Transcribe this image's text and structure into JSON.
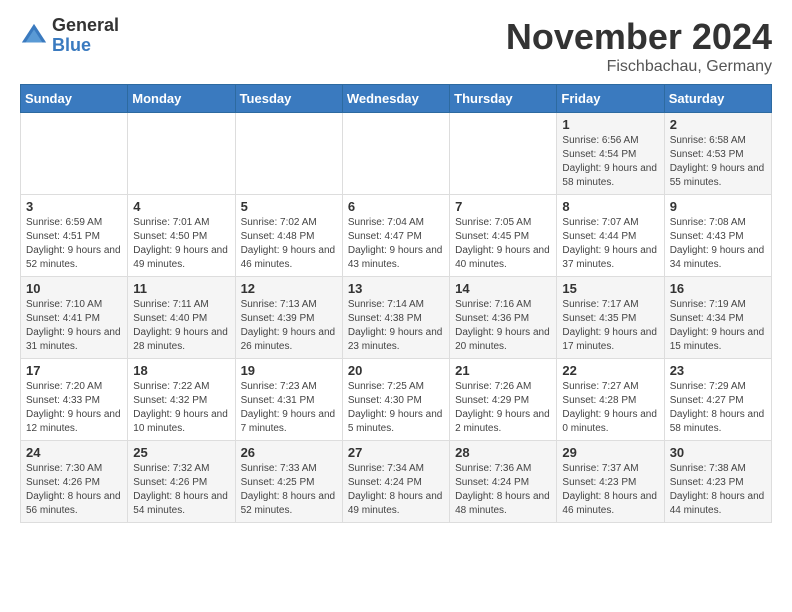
{
  "header": {
    "logo_general": "General",
    "logo_blue": "Blue",
    "title": "November 2024",
    "location": "Fischbachau, Germany"
  },
  "weekdays": [
    "Sunday",
    "Monday",
    "Tuesday",
    "Wednesday",
    "Thursday",
    "Friday",
    "Saturday"
  ],
  "weeks": [
    [
      {
        "day": "",
        "info": ""
      },
      {
        "day": "",
        "info": ""
      },
      {
        "day": "",
        "info": ""
      },
      {
        "day": "",
        "info": ""
      },
      {
        "day": "",
        "info": ""
      },
      {
        "day": "1",
        "info": "Sunrise: 6:56 AM\nSunset: 4:54 PM\nDaylight: 9 hours and 58 minutes."
      },
      {
        "day": "2",
        "info": "Sunrise: 6:58 AM\nSunset: 4:53 PM\nDaylight: 9 hours and 55 minutes."
      }
    ],
    [
      {
        "day": "3",
        "info": "Sunrise: 6:59 AM\nSunset: 4:51 PM\nDaylight: 9 hours and 52 minutes."
      },
      {
        "day": "4",
        "info": "Sunrise: 7:01 AM\nSunset: 4:50 PM\nDaylight: 9 hours and 49 minutes."
      },
      {
        "day": "5",
        "info": "Sunrise: 7:02 AM\nSunset: 4:48 PM\nDaylight: 9 hours and 46 minutes."
      },
      {
        "day": "6",
        "info": "Sunrise: 7:04 AM\nSunset: 4:47 PM\nDaylight: 9 hours and 43 minutes."
      },
      {
        "day": "7",
        "info": "Sunrise: 7:05 AM\nSunset: 4:45 PM\nDaylight: 9 hours and 40 minutes."
      },
      {
        "day": "8",
        "info": "Sunrise: 7:07 AM\nSunset: 4:44 PM\nDaylight: 9 hours and 37 minutes."
      },
      {
        "day": "9",
        "info": "Sunrise: 7:08 AM\nSunset: 4:43 PM\nDaylight: 9 hours and 34 minutes."
      }
    ],
    [
      {
        "day": "10",
        "info": "Sunrise: 7:10 AM\nSunset: 4:41 PM\nDaylight: 9 hours and 31 minutes."
      },
      {
        "day": "11",
        "info": "Sunrise: 7:11 AM\nSunset: 4:40 PM\nDaylight: 9 hours and 28 minutes."
      },
      {
        "day": "12",
        "info": "Sunrise: 7:13 AM\nSunset: 4:39 PM\nDaylight: 9 hours and 26 minutes."
      },
      {
        "day": "13",
        "info": "Sunrise: 7:14 AM\nSunset: 4:38 PM\nDaylight: 9 hours and 23 minutes."
      },
      {
        "day": "14",
        "info": "Sunrise: 7:16 AM\nSunset: 4:36 PM\nDaylight: 9 hours and 20 minutes."
      },
      {
        "day": "15",
        "info": "Sunrise: 7:17 AM\nSunset: 4:35 PM\nDaylight: 9 hours and 17 minutes."
      },
      {
        "day": "16",
        "info": "Sunrise: 7:19 AM\nSunset: 4:34 PM\nDaylight: 9 hours and 15 minutes."
      }
    ],
    [
      {
        "day": "17",
        "info": "Sunrise: 7:20 AM\nSunset: 4:33 PM\nDaylight: 9 hours and 12 minutes."
      },
      {
        "day": "18",
        "info": "Sunrise: 7:22 AM\nSunset: 4:32 PM\nDaylight: 9 hours and 10 minutes."
      },
      {
        "day": "19",
        "info": "Sunrise: 7:23 AM\nSunset: 4:31 PM\nDaylight: 9 hours and 7 minutes."
      },
      {
        "day": "20",
        "info": "Sunrise: 7:25 AM\nSunset: 4:30 PM\nDaylight: 9 hours and 5 minutes."
      },
      {
        "day": "21",
        "info": "Sunrise: 7:26 AM\nSunset: 4:29 PM\nDaylight: 9 hours and 2 minutes."
      },
      {
        "day": "22",
        "info": "Sunrise: 7:27 AM\nSunset: 4:28 PM\nDaylight: 9 hours and 0 minutes."
      },
      {
        "day": "23",
        "info": "Sunrise: 7:29 AM\nSunset: 4:27 PM\nDaylight: 8 hours and 58 minutes."
      }
    ],
    [
      {
        "day": "24",
        "info": "Sunrise: 7:30 AM\nSunset: 4:26 PM\nDaylight: 8 hours and 56 minutes."
      },
      {
        "day": "25",
        "info": "Sunrise: 7:32 AM\nSunset: 4:26 PM\nDaylight: 8 hours and 54 minutes."
      },
      {
        "day": "26",
        "info": "Sunrise: 7:33 AM\nSunset: 4:25 PM\nDaylight: 8 hours and 52 minutes."
      },
      {
        "day": "27",
        "info": "Sunrise: 7:34 AM\nSunset: 4:24 PM\nDaylight: 8 hours and 49 minutes."
      },
      {
        "day": "28",
        "info": "Sunrise: 7:36 AM\nSunset: 4:24 PM\nDaylight: 8 hours and 48 minutes."
      },
      {
        "day": "29",
        "info": "Sunrise: 7:37 AM\nSunset: 4:23 PM\nDaylight: 8 hours and 46 minutes."
      },
      {
        "day": "30",
        "info": "Sunrise: 7:38 AM\nSunset: 4:23 PM\nDaylight: 8 hours and 44 minutes."
      }
    ]
  ]
}
